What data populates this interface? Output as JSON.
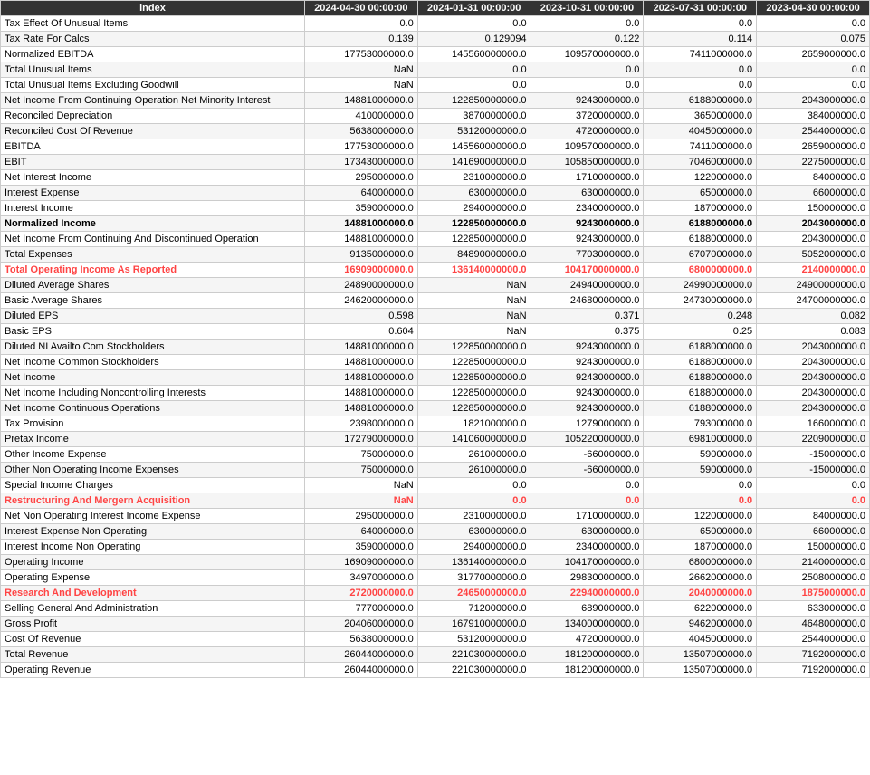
{
  "table": {
    "columns": [
      "index",
      "2024-04-30 00:00:00",
      "2024-01-31 00:00:00",
      "2023-10-31 00:00:00",
      "2023-07-31 00:00:00",
      "2023-04-30 00:00:00"
    ],
    "rows": [
      {
        "label": "Tax Effect Of Unusual Items",
        "values": [
          "0.0",
          "0.0",
          "0.0",
          "0.0",
          "0.0"
        ],
        "style": ""
      },
      {
        "label": "Tax Rate For Calcs",
        "values": [
          "0.139",
          "0.129094",
          "0.122",
          "0.114",
          "0.075"
        ],
        "style": ""
      },
      {
        "label": "Normalized EBITDA",
        "values": [
          "17753000000.0",
          "145560000000.0",
          "109570000000.0",
          "7411000000.0",
          "2659000000.0"
        ],
        "style": ""
      },
      {
        "label": "Total Unusual Items",
        "values": [
          "NaN",
          "0.0",
          "0.0",
          "0.0",
          "0.0"
        ],
        "style": ""
      },
      {
        "label": "Total Unusual Items Excluding Goodwill",
        "values": [
          "NaN",
          "0.0",
          "0.0",
          "0.0",
          "0.0"
        ],
        "style": ""
      },
      {
        "label": "Net Income From Continuing Operation Net Minority Interest",
        "values": [
          "14881000000.0",
          "122850000000.0",
          "9243000000.0",
          "6188000000.0",
          "2043000000.0"
        ],
        "style": ""
      },
      {
        "label": "Reconciled Depreciation",
        "values": [
          "410000000.0",
          "3870000000.0",
          "3720000000.0",
          "365000000.0",
          "384000000.0"
        ],
        "style": ""
      },
      {
        "label": "Reconciled Cost Of Revenue",
        "values": [
          "5638000000.0",
          "53120000000.0",
          "4720000000.0",
          "4045000000.0",
          "2544000000.0"
        ],
        "style": ""
      },
      {
        "label": "EBITDA",
        "values": [
          "17753000000.0",
          "145560000000.0",
          "109570000000.0",
          "7411000000.0",
          "2659000000.0"
        ],
        "style": ""
      },
      {
        "label": "EBIT",
        "values": [
          "17343000000.0",
          "141690000000.0",
          "105850000000.0",
          "7046000000.0",
          "2275000000.0"
        ],
        "style": ""
      },
      {
        "label": "Net Interest Income",
        "values": [
          "295000000.0",
          "2310000000.0",
          "1710000000.0",
          "122000000.0",
          "84000000.0"
        ],
        "style": ""
      },
      {
        "label": "Interest Expense",
        "values": [
          "64000000.0",
          "630000000.0",
          "630000000.0",
          "65000000.0",
          "66000000.0"
        ],
        "style": ""
      },
      {
        "label": "Interest Income",
        "values": [
          "359000000.0",
          "2940000000.0",
          "2340000000.0",
          "187000000.0",
          "150000000.0"
        ],
        "style": ""
      },
      {
        "label": "Normalized Income",
        "values": [
          "14881000000.0",
          "122850000000.0",
          "9243000000.0",
          "6188000000.0",
          "2043000000.0"
        ],
        "style": "bold-row"
      },
      {
        "label": "Net Income From Continuing And Discontinued Operation",
        "values": [
          "14881000000.0",
          "122850000000.0",
          "9243000000.0",
          "6188000000.0",
          "2043000000.0"
        ],
        "style": ""
      },
      {
        "label": "Total Expenses",
        "values": [
          "9135000000.0",
          "84890000000.0",
          "7703000000.0",
          "6707000000.0",
          "5052000000.0"
        ],
        "style": ""
      },
      {
        "label": "Total Operating Income As Reported",
        "values": [
          "16909000000.0",
          "136140000000.0",
          "104170000000.0",
          "6800000000.0",
          "2140000000.0"
        ],
        "style": "highlight-row"
      },
      {
        "label": "Diluted Average Shares",
        "values": [
          "24890000000.0",
          "NaN",
          "24940000000.0",
          "24990000000.0",
          "24900000000.0"
        ],
        "style": ""
      },
      {
        "label": "Basic Average Shares",
        "values": [
          "24620000000.0",
          "NaN",
          "24680000000.0",
          "24730000000.0",
          "24700000000.0"
        ],
        "style": ""
      },
      {
        "label": "Diluted EPS",
        "values": [
          "0.598",
          "NaN",
          "0.371",
          "0.248",
          "0.082"
        ],
        "style": ""
      },
      {
        "label": "Basic EPS",
        "values": [
          "0.604",
          "NaN",
          "0.375",
          "0.25",
          "0.083"
        ],
        "style": ""
      },
      {
        "label": "Diluted NI Availto Com Stockholders",
        "values": [
          "14881000000.0",
          "122850000000.0",
          "9243000000.0",
          "6188000000.0",
          "2043000000.0"
        ],
        "style": ""
      },
      {
        "label": "Net Income Common Stockholders",
        "values": [
          "14881000000.0",
          "122850000000.0",
          "9243000000.0",
          "6188000000.0",
          "2043000000.0"
        ],
        "style": ""
      },
      {
        "label": "Net Income",
        "values": [
          "14881000000.0",
          "122850000000.0",
          "9243000000.0",
          "6188000000.0",
          "2043000000.0"
        ],
        "style": ""
      },
      {
        "label": "Net Income Including Noncontrolling Interests",
        "values": [
          "14881000000.0",
          "122850000000.0",
          "9243000000.0",
          "6188000000.0",
          "2043000000.0"
        ],
        "style": ""
      },
      {
        "label": "Net Income Continuous Operations",
        "values": [
          "14881000000.0",
          "122850000000.0",
          "9243000000.0",
          "6188000000.0",
          "2043000000.0"
        ],
        "style": ""
      },
      {
        "label": "Tax Provision",
        "values": [
          "2398000000.0",
          "1821000000.0",
          "1279000000.0",
          "793000000.0",
          "166000000.0"
        ],
        "style": ""
      },
      {
        "label": "Pretax Income",
        "values": [
          "17279000000.0",
          "141060000000.0",
          "105220000000.0",
          "6981000000.0",
          "2209000000.0"
        ],
        "style": ""
      },
      {
        "label": "Other Income Expense",
        "values": [
          "75000000.0",
          "261000000.0",
          "-66000000.0",
          "59000000.0",
          "-15000000.0"
        ],
        "style": ""
      },
      {
        "label": "Other Non Operating Income Expenses",
        "values": [
          "75000000.0",
          "261000000.0",
          "-66000000.0",
          "59000000.0",
          "-15000000.0"
        ],
        "style": ""
      },
      {
        "label": "Special Income Charges",
        "values": [
          "NaN",
          "0.0",
          "0.0",
          "0.0",
          "0.0"
        ],
        "style": ""
      },
      {
        "label": "Restructuring And Mergern Acquisition",
        "values": [
          "NaN",
          "0.0",
          "0.0",
          "0.0",
          "0.0"
        ],
        "style": "highlight-row"
      },
      {
        "label": "Net Non Operating Interest Income Expense",
        "values": [
          "295000000.0",
          "2310000000.0",
          "1710000000.0",
          "122000000.0",
          "84000000.0"
        ],
        "style": ""
      },
      {
        "label": "Interest Expense Non Operating",
        "values": [
          "64000000.0",
          "630000000.0",
          "630000000.0",
          "65000000.0",
          "66000000.0"
        ],
        "style": ""
      },
      {
        "label": "Interest Income Non Operating",
        "values": [
          "359000000.0",
          "2940000000.0",
          "2340000000.0",
          "187000000.0",
          "150000000.0"
        ],
        "style": ""
      },
      {
        "label": "Operating Income",
        "values": [
          "16909000000.0",
          "136140000000.0",
          "104170000000.0",
          "6800000000.0",
          "2140000000.0"
        ],
        "style": ""
      },
      {
        "label": "Operating Expense",
        "values": [
          "3497000000.0",
          "31770000000.0",
          "29830000000.0",
          "2662000000.0",
          "2508000000.0"
        ],
        "style": ""
      },
      {
        "label": "Research And Development",
        "values": [
          "2720000000.0",
          "24650000000.0",
          "22940000000.0",
          "2040000000.0",
          "1875000000.0"
        ],
        "style": "highlight-row"
      },
      {
        "label": "Selling General And Administration",
        "values": [
          "777000000.0",
          "712000000.0",
          "689000000.0",
          "622000000.0",
          "633000000.0"
        ],
        "style": ""
      },
      {
        "label": "Gross Profit",
        "values": [
          "20406000000.0",
          "167910000000.0",
          "134000000000.0",
          "9462000000.0",
          "4648000000.0"
        ],
        "style": ""
      },
      {
        "label": "Cost Of Revenue",
        "values": [
          "5638000000.0",
          "53120000000.0",
          "4720000000.0",
          "4045000000.0",
          "2544000000.0"
        ],
        "style": ""
      },
      {
        "label": "Total Revenue",
        "values": [
          "26044000000.0",
          "221030000000.0",
          "181200000000.0",
          "13507000000.0",
          "7192000000.0"
        ],
        "style": ""
      },
      {
        "label": "Operating Revenue",
        "values": [
          "26044000000.0",
          "221030000000.0",
          "181200000000.0",
          "13507000000.0",
          "7192000000.0"
        ],
        "style": ""
      }
    ]
  }
}
